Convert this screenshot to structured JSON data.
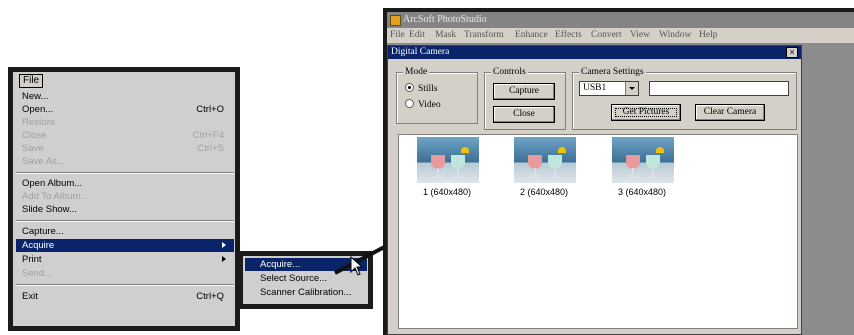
{
  "file_menu": {
    "title": "File",
    "items": [
      {
        "label": "New...",
        "shortcut": "",
        "disabled": false
      },
      {
        "label": "Open...",
        "shortcut": "Ctrl+O",
        "disabled": false
      },
      {
        "label": "Restore",
        "shortcut": "",
        "disabled": true
      },
      {
        "label": "Close",
        "shortcut": "Ctrl+F4",
        "disabled": true
      },
      {
        "label": "Save",
        "shortcut": "Ctrl+S",
        "disabled": true
      },
      {
        "label": "Save As...",
        "shortcut": "",
        "disabled": true
      },
      {
        "label": "Open Album...",
        "shortcut": "",
        "disabled": false
      },
      {
        "label": "Add To Album...",
        "shortcut": "",
        "disabled": true
      },
      {
        "label": "Slide Show...",
        "shortcut": "",
        "disabled": false
      },
      {
        "label": "Capture...",
        "shortcut": "",
        "disabled": false
      },
      {
        "label": "Acquire",
        "shortcut": "",
        "disabled": false,
        "highlighted": true
      },
      {
        "label": "Print",
        "shortcut": "",
        "disabled": false
      },
      {
        "label": "Send...",
        "shortcut": "",
        "disabled": true
      },
      {
        "label": "Exit",
        "shortcut": "Ctrl+Q",
        "disabled": false
      }
    ]
  },
  "acquire_submenu": {
    "items": [
      "Acquire...",
      "Select Source...",
      "Scanner Calibration..."
    ]
  },
  "app": {
    "title": "ArcSoft PhotoStudio",
    "menubar": [
      "File",
      "Edit",
      "Mask",
      "Transform",
      "Enhance",
      "Effects",
      "Convert",
      "View",
      "Window",
      "Help"
    ]
  },
  "dialog": {
    "title": "Digital Camera",
    "close_glyph": "×",
    "mode": {
      "label": "Mode",
      "stills": "Stills",
      "video": "Video",
      "selected": "Stills"
    },
    "controls": {
      "label": "Controls",
      "capture": "Capture",
      "close": "Close"
    },
    "camera_settings": {
      "label": "Camera Settings",
      "port_value": "USB1",
      "text_value": "",
      "get_pictures": "Get Pictures",
      "clear_camera": "Clear Camera"
    },
    "thumbnails": [
      "1 (640x480)",
      "2 (640x480)",
      "3 (640x480)"
    ]
  },
  "colors": {
    "highlight": "#0a246a",
    "menu_bg": "#cfcfcf",
    "frame": "#1a1a1a"
  }
}
